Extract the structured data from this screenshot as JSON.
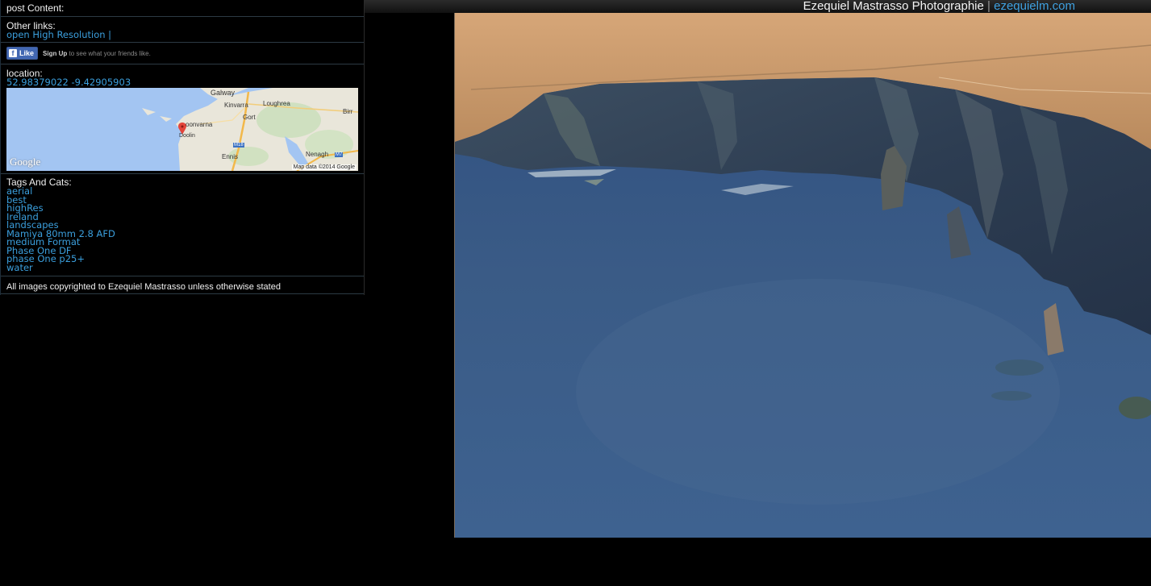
{
  "header": {
    "site_title": "Ezequiel Mastrasso Photographie",
    "separator": "|",
    "site_link": "ezequielm.com"
  },
  "sidebar": {
    "post_content_label": "post Content:",
    "other_links_label": "Other links:",
    "high_res_link": "open High Resolution |",
    "facebook": {
      "like_label": "Like",
      "signup_label": "Sign Up",
      "signup_suffix": "to see what your friends like."
    },
    "location_label": "location:",
    "location_coords": "52.98379022 -9.42905903",
    "map": {
      "places": [
        "Galway",
        "Kinvarra",
        "Loughrea",
        "Gort",
        "Birr",
        "oonvarna",
        "Doolin",
        "Ennis",
        "Nenagh"
      ],
      "road_labels": [
        "M18",
        "M7"
      ],
      "google_label": "Google",
      "map_data_label": "Map data ©2014 Google"
    },
    "tags_label": "Tags And Cats:",
    "tags": [
      "aerial",
      "best",
      "highRes",
      "Ireland",
      "landscapes",
      "Mamiya 80mm 2.8 AFD",
      "medium Format",
      "Phase One DF",
      "phase One p25+",
      "water"
    ],
    "copyright": "All images copyrighted to Ezequiel Mastrasso unless otherwise stated"
  },
  "colors": {
    "link": "#3b9fdd",
    "background": "#000000",
    "facebook_blue": "#4267b2"
  }
}
